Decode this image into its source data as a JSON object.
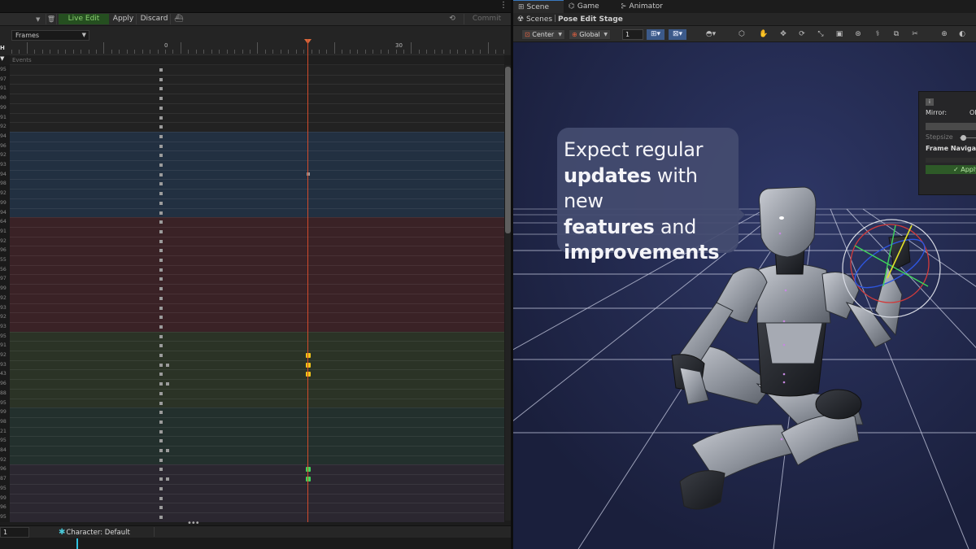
{
  "left_toolbar": {
    "live_edit": "Live Edit",
    "apply": "Apply",
    "discard": "Discard",
    "commit": "Commit"
  },
  "timeline": {
    "units_dropdown": "Frames",
    "ruler_labels": [
      "0",
      "30"
    ],
    "events_label": "Events",
    "row_numbers": [
      "95",
      "97",
      "91",
      "00",
      "99",
      "91",
      "92",
      "94",
      "96",
      "92",
      "93",
      "94",
      "98",
      "92",
      "99",
      "94",
      "64",
      "91",
      "92",
      "96",
      "55",
      "56",
      "97",
      "99",
      "92",
      "93",
      "92",
      "93",
      "95",
      "91",
      "92",
      "93",
      "43",
      "96",
      "88",
      "95",
      "99",
      "98",
      "21",
      "95",
      "84",
      "92",
      "96",
      "87",
      "95",
      "99",
      "96",
      "95"
    ],
    "current_frame": "1",
    "character_label": "Character: Default",
    "bands": [
      {
        "color": "#222222"
      },
      {
        "color": "#223041"
      },
      {
        "color": "#3a2226"
      },
      {
        "color": "#2b3326"
      },
      {
        "color": "#23302d"
      },
      {
        "color": "#2b2730"
      }
    ],
    "keyframe_colors": {
      "default": "#9b9b9b",
      "yellow": "#f0c419",
      "green": "#3fd45a"
    },
    "playhead_color": "#d24b2c"
  },
  "scene_tabs": {
    "tabs": [
      "Scene",
      "Game",
      "Animator"
    ],
    "active": "Scene"
  },
  "breadcrumbs": {
    "root": "Scenes",
    "current": "Pose Edit Stage"
  },
  "scene_toolbar": {
    "pivot": "Center",
    "space": "Global",
    "snap_value": "1"
  },
  "overlay_panel": {
    "toggle": "i",
    "mirror_label": "Mirror:",
    "mirror_value": "OF",
    "stepsize_label": "Stepsize",
    "frame_nav_label": "Frame Navigat",
    "apply_label": "✓ Apply"
  },
  "callout": {
    "line1_a": "Expect regular",
    "line2_b": "updates",
    "line2_a": " with new",
    "line3_b": "features",
    "line3_a": " and",
    "line4_b": "improvements"
  },
  "colors": {
    "viewport_bg": "#1c2140",
    "live_edit_bg": "#254f20",
    "tab_accent": "#3a79bf"
  }
}
